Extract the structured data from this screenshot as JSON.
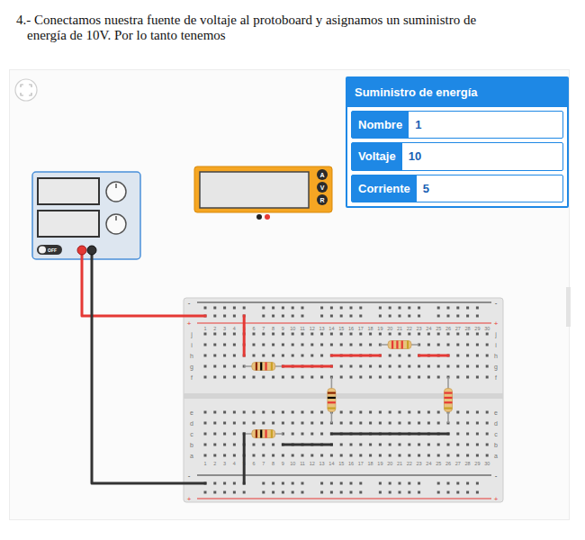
{
  "instruction": {
    "lines": [
      "4.- Conectamos nuestra fuente de voltaje al protoboard y asignamos un suministro de",
      "energía de 10V. Por lo tanto tenemos"
    ]
  },
  "properties_panel": {
    "title": "Suministro de energía",
    "fields": [
      {
        "label": "Nombre",
        "value": "1"
      },
      {
        "label": "Voltaje",
        "value": "10"
      },
      {
        "label": "Corriente",
        "value": "5"
      }
    ]
  },
  "power_supply": {
    "switch_label": "OFF",
    "on": false
  },
  "multimeter": {
    "buttons": [
      "A",
      "V",
      "R"
    ]
  },
  "breadboard": {
    "columns": [
      "1",
      "2",
      "3",
      "4",
      "5",
      "6",
      "7",
      "8",
      "9",
      "10",
      "11",
      "12",
      "13",
      "14",
      "15",
      "16",
      "17",
      "18",
      "19",
      "20",
      "21",
      "22",
      "23",
      "24",
      "25",
      "26",
      "27",
      "28",
      "29",
      "30"
    ],
    "top_rows": [
      "j",
      "i",
      "h",
      "g",
      "f"
    ],
    "bottom_rows": [
      "e",
      "d",
      "c",
      "b",
      "a"
    ],
    "rail_signs": [
      "-",
      "+"
    ]
  },
  "components": [
    {
      "kind": "wire",
      "color": "#e53935",
      "from": "supply+",
      "to": "top+1"
    },
    {
      "kind": "wire",
      "color": "#333333",
      "from": "supply-",
      "to": "bot-1"
    },
    {
      "kind": "wire",
      "color": "#e53935",
      "from": "top+5",
      "to": "h5"
    },
    {
      "kind": "resistor",
      "bands": [
        "#8b2500",
        "#000000",
        "#e53935",
        "#c9a227"
      ],
      "from": "g5",
      "to": "g9"
    },
    {
      "kind": "wire",
      "color": "#e53935",
      "from": "g9",
      "to": "g14"
    },
    {
      "kind": "wire",
      "color": "#e53935",
      "from": "h14",
      "to": "h19"
    },
    {
      "kind": "resistor",
      "bands": [
        "#e53935",
        "#e53935",
        "#e53935",
        "#c9a227"
      ],
      "from": "i19",
      "to": "i23"
    },
    {
      "kind": "wire",
      "color": "#e53935",
      "from": "h23",
      "to": "h26"
    },
    {
      "kind": "resistor",
      "bands": [
        "#8b2500",
        "#000000",
        "#e53935",
        "#c9a227"
      ],
      "from": "f14",
      "to": "d14"
    },
    {
      "kind": "resistor",
      "bands": [
        "#e53935",
        "#e53935",
        "#e53935",
        "#c9a227"
      ],
      "from": "f26",
      "to": "d26"
    },
    {
      "kind": "resistor",
      "bands": [
        "#8b2500",
        "#000000",
        "#e53935",
        "#c9a227"
      ],
      "from": "c5",
      "to": "c9"
    },
    {
      "kind": "wire",
      "color": "#333333",
      "from": "c5",
      "to": "bot-5"
    },
    {
      "kind": "wire",
      "color": "#333333",
      "from": "b9",
      "to": "b14"
    },
    {
      "kind": "wire",
      "color": "#333333",
      "from": "c14",
      "to": "c26"
    }
  ]
}
